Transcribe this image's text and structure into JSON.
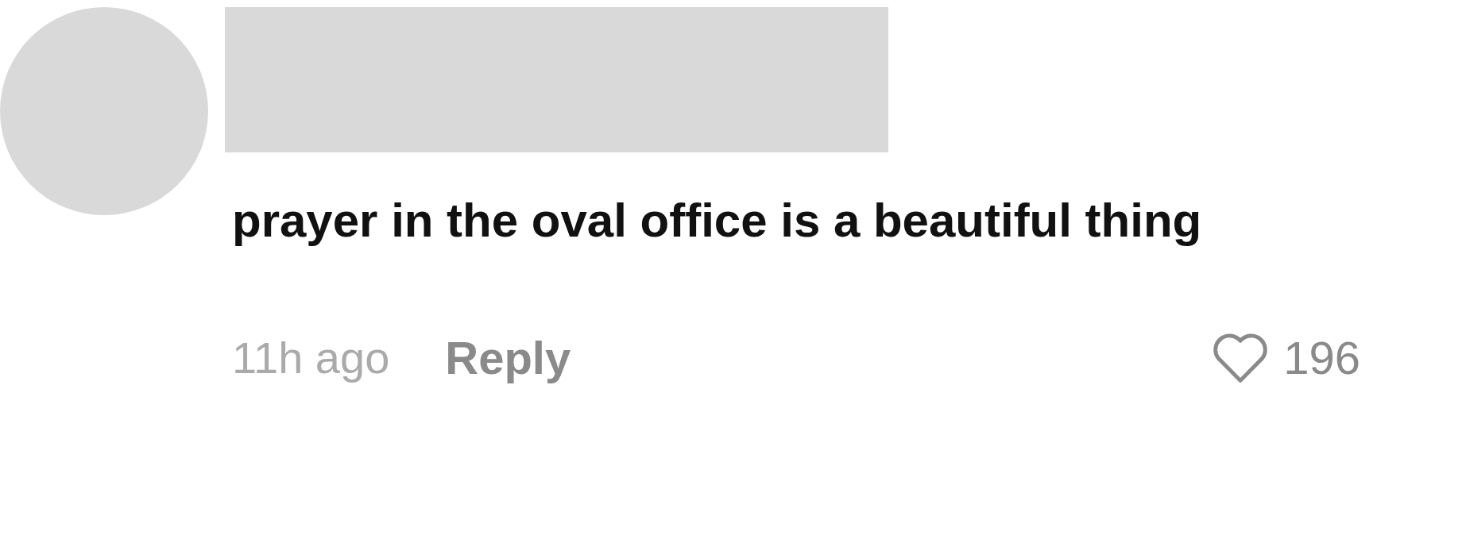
{
  "comment": {
    "text": "prayer in the oval office is a beautiful thing",
    "time": "11h ago",
    "reply": "Reply",
    "likes": "196"
  }
}
